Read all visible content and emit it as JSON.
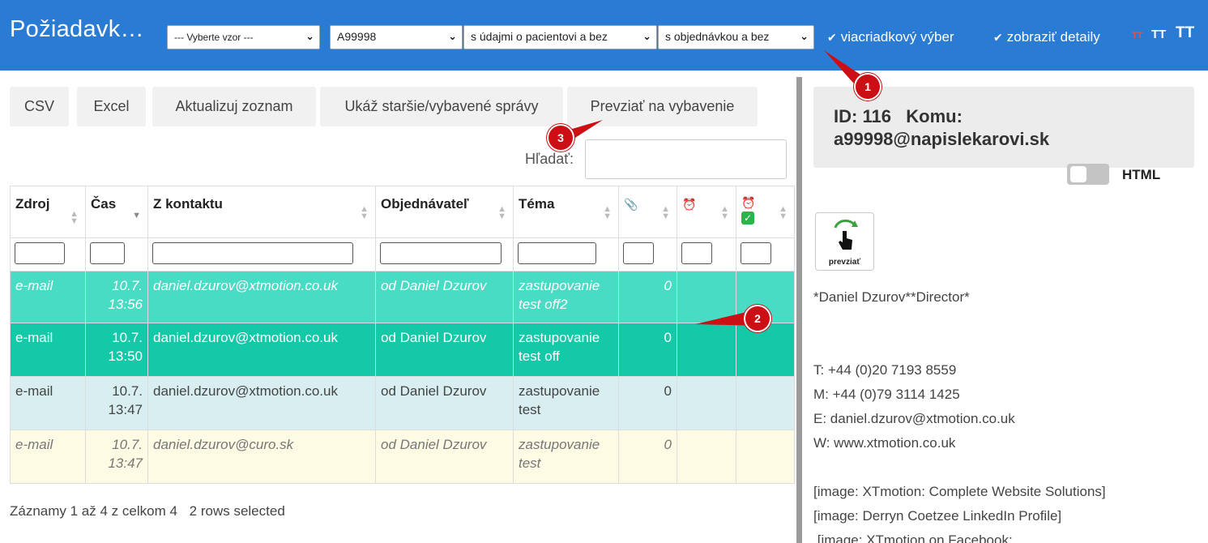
{
  "app_title": "Požiadavk…",
  "filters": {
    "template": "--- Vyberte vzor ---",
    "account": "A99998",
    "patient": "s údajmi o pacientovi a bez",
    "order": "s objednávkou a bez"
  },
  "checkboxes": {
    "multi_row": "viacriadkový výber",
    "show_details": "zobraziť detaily"
  },
  "font_size_buttons": [
    "TT",
    "TT",
    "TT"
  ],
  "toolbar": {
    "csv": "CSV",
    "excel": "Excel",
    "refresh": "Aktualizuj zoznam",
    "show_older": "Ukáž staršie/vybavené správy",
    "take_over": "Prevziať na vybavenie"
  },
  "search": {
    "label": "Hľadať:",
    "value": ""
  },
  "table": {
    "columns": [
      "Zdroj",
      "Čas",
      "Z kontaktu",
      "Objednávateľ",
      "Téma",
      "",
      "",
      ""
    ],
    "icon_columns": [
      "paperclip-icon",
      "alarm-clock-icon",
      "alarm-clock-check-icon"
    ],
    "rows": [
      {
        "source": "e-mail",
        "date": "10.7.",
        "time": "13:56",
        "contact": "daniel.dzurov@xtmotion.co.uk",
        "orderer": "od Daniel Dzurov",
        "topic_1": "zastupovanie",
        "topic_2": "test off2",
        "attachments": "0"
      },
      {
        "source": "e-mail",
        "date": "10.7.",
        "time": "13:50",
        "contact": "daniel.dzurov@xtmotion.co.uk",
        "orderer": "od Daniel Dzurov",
        "topic_1": "zastupovanie",
        "topic_2": "test off",
        "attachments": "0"
      },
      {
        "source": "e-mail",
        "date": "10.7.",
        "time": "13:47",
        "contact": "daniel.dzurov@xtmotion.co.uk",
        "orderer": "od Daniel Dzurov",
        "topic_1": "zastupovanie",
        "topic_2": "test",
        "attachments": "0"
      },
      {
        "source": "e-mail",
        "date": "10.7.",
        "time": "13:47",
        "contact": "daniel.dzurov@curo.sk",
        "orderer": "od Daniel Dzurov",
        "topic_1": "zastupovanie",
        "topic_2": "test",
        "attachments": "0"
      }
    ]
  },
  "footer": {
    "records": "Záznamy 1 až 4 z celkom 4",
    "selected": "2 rows selected"
  },
  "detail": {
    "id_line": "ID: 116   Komu:",
    "recipient": "a99998@napislekarovi.sk",
    "html_toggle_label": "HTML",
    "take_button_label": "prevziať",
    "body_lines": [
      "*Daniel Dzurov**Director*",
      "",
      "",
      "T: +44 (0)20 7193 8559",
      "M: +44 (0)79 3114 1425",
      "E: daniel.dzurov@xtmotion.co.uk",
      "W: www.xtmotion.co.uk",
      "",
      "[image: XTmotion: Complete Website Solutions]",
      "[image: Derryn Coetzee LinkedIn Profile]",
      " [image: XTmotion on Facebook:"
    ]
  },
  "annotations": [
    "1",
    "2",
    "3"
  ],
  "colors": {
    "topbar": "#2a7bd3",
    "row_selected_1": "#48dcc5",
    "row_selected_2": "#13c9a8",
    "row_normal": "#d9eef0",
    "row_other": "#fdfbe4",
    "marker": "#cc0f15"
  }
}
